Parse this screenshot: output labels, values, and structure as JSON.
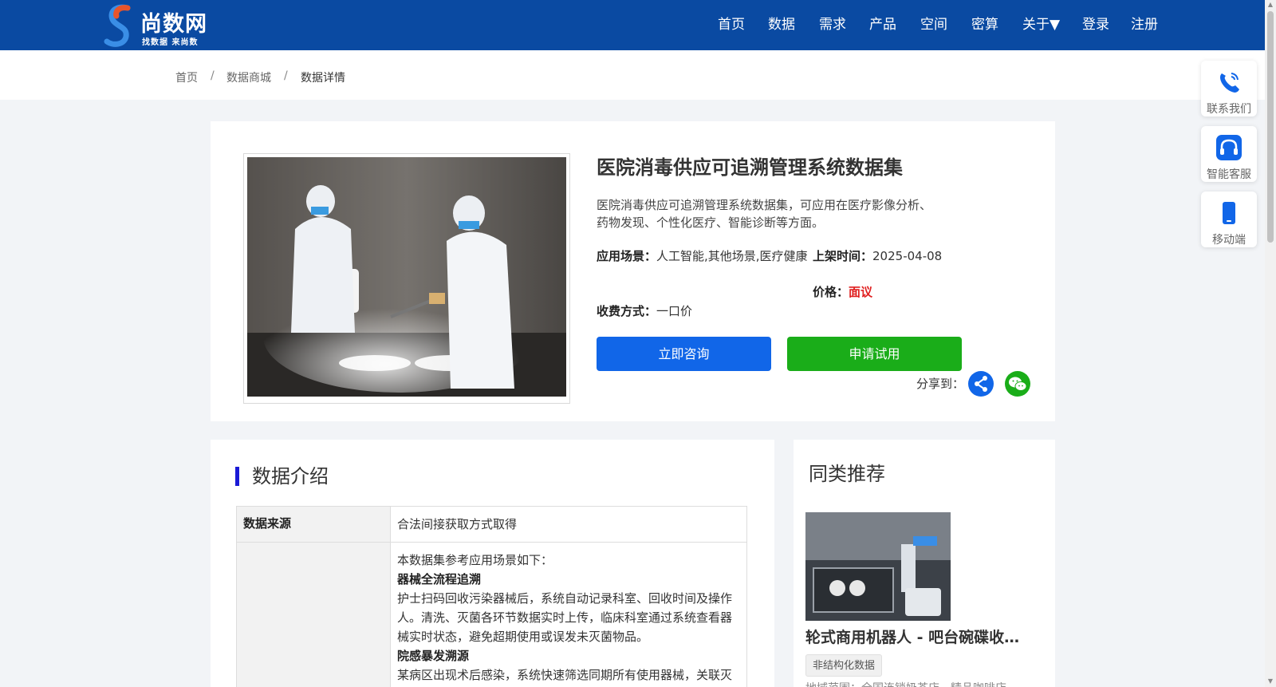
{
  "brand": {
    "name": "尚数网",
    "slogan": "找数据  来尚数",
    "colors": {
      "header": "#0a4aa2",
      "primary": "#1166e8",
      "green": "#1aad19",
      "price": "#e02020"
    }
  },
  "nav": {
    "items": [
      "首页",
      "数据",
      "需求",
      "产品",
      "空间",
      "密算",
      "关于▼"
    ],
    "login": "登录",
    "register": "注册"
  },
  "breadcrumb": {
    "items": [
      "首页",
      "数据商城",
      "数据详情"
    ],
    "separator": "/"
  },
  "product": {
    "title": "医院消毒供应可追溯管理系统数据集",
    "description": "医院消毒供应可追溯管理系统数据集，可应用在医疗影像分析、药物发现、个性化医疗、智能诊断等方面。",
    "scene_label": "应用场景：",
    "scene_value": "人工智能,其他场景,医疗健康",
    "date_label": "上架时间：",
    "date_value": "2025-04-08",
    "price_label": "价格：",
    "price_value": "面议",
    "charge_label": "收费方式：",
    "charge_value": "一口价",
    "consult_button": "立即咨询",
    "trial_button": "申请试用",
    "share_label": "分享到："
  },
  "intro": {
    "title": "数据介绍",
    "source_key": "数据来源",
    "source_value": "合法间接获取方式取得",
    "scene_intro": "本数据集参考应用场景如下：",
    "scenes": [
      {
        "heading": "器械全流程追溯",
        "text": "护士扫码回收污染器械后，系统自动记录科室、回收时间及操作人。清洗、灭菌各环节数据实时上传，临床科室通过系统查看器械实时状态，避免超期使用或误发未灭菌物品。"
      },
      {
        "heading": "院感暴发溯源",
        "text": "某病区出现术后感染，系统快速筛选同期所有使用器械，关联灭菌参数、生物监测结果及操作人员。"
      }
    ]
  },
  "recommend": {
    "title": "同类推荐",
    "items": [
      {
        "name": "轮式商用机器人 - 吧台碗碟收纳数据集",
        "tag": "非结构化数据",
        "summary": "地域范围：全国连锁奶茶店、精品咖啡店"
      }
    ]
  },
  "widgets": {
    "contact": "联系我们",
    "service": "智能客服",
    "mobile": "移动端"
  }
}
